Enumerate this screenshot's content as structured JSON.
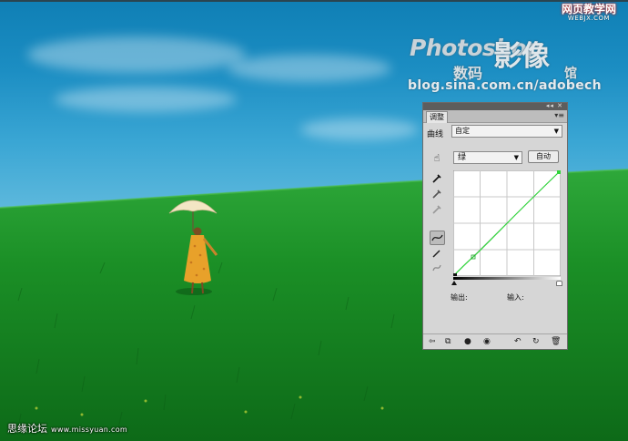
{
  "watermark": {
    "title": "Photoshop",
    "big": "影像",
    "small1": "数码",
    "small2": "馆",
    "url": "blog.sina.com.cn/adobech"
  },
  "site_badge": {
    "line1": "网页教学网",
    "line2": "WEBJX.COM"
  },
  "bottom_watermark": {
    "name": "思缘论坛",
    "url": "www.missyuan.com"
  },
  "panel": {
    "tab": "调整",
    "menu_icon": "panel-menu-icon",
    "adjustment_label": "曲线",
    "preset_value": "自定",
    "channel_value": "绿",
    "auto_button": "自动",
    "output_label": "输出:",
    "input_label": "输入:",
    "curve_color": "#2fd43a",
    "tools": [
      "on-image-adjust-icon",
      "black-eyedropper-icon",
      "gray-eyedropper-icon",
      "white-eyedropper-icon",
      "curve-points-icon",
      "pencil-icon",
      "smooth-icon"
    ],
    "bottom_icons": [
      "return-icon",
      "clip-layer-icon",
      "visibility-icon",
      "eye-icon",
      "previous-state-icon",
      "reset-icon",
      "delete-icon"
    ]
  },
  "colors": {
    "panel_bg": "#d6d6d6",
    "sky": "#1c8ec3",
    "grass": "#1a8a1e"
  }
}
